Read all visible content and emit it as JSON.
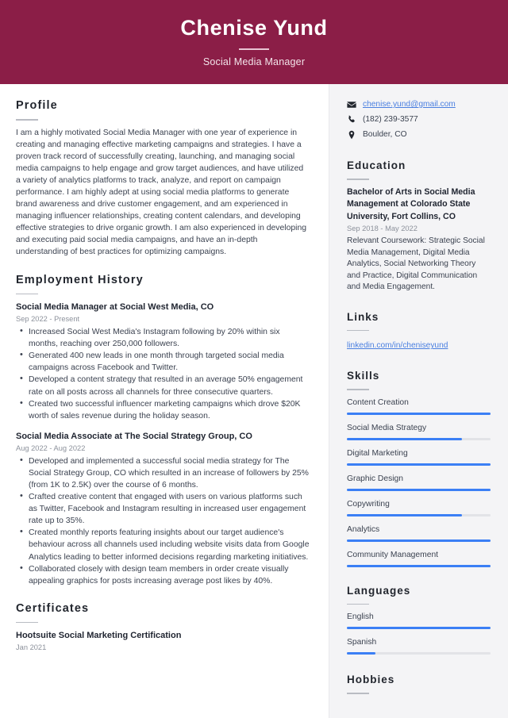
{
  "header": {
    "name": "Chenise Yund",
    "job_title": "Social Media Manager",
    "bg_color": "#8b1e47"
  },
  "main": {
    "profile": {
      "heading": "Profile",
      "text": "I am a highly motivated Social Media Manager with one year of experience in creating and managing effective marketing campaigns and strategies. I have a proven track record of successfully creating, launching, and managing social media campaigns to help engage and grow target audiences, and have utilized a variety of analytics platforms to track, analyze, and report on campaign performance. I am highly adept at using social media platforms to generate brand awareness and drive customer engagement, and am experienced in managing influencer relationships, creating content calendars, and developing effective strategies to drive organic growth. I am also experienced in developing and executing paid social media campaigns, and have an in-depth understanding of best practices for optimizing campaigns."
    },
    "employment": {
      "heading": "Employment History",
      "jobs": [
        {
          "title": "Social Media Manager at Social West Media, CO",
          "date": "Sep 2022 - Present",
          "bullets": [
            "Increased Social West Media's Instagram following by 20% within six months, reaching over 250,000 followers.",
            "Generated 400 new leads in one month through targeted social media campaigns across Facebook and Twitter.",
            "Developed a content strategy that resulted in an average 50% engagement rate on all posts across all channels for three consecutive quarters.",
            "Created two successful influencer marketing campaigns which drove $20K worth of sales revenue during the holiday season."
          ]
        },
        {
          "title": "Social Media Associate at The Social Strategy Group, CO",
          "date": "Aug 2022 - Aug 2022",
          "bullets": [
            "Developed and implemented a successful social media strategy for The Social Strategy Group, CO which resulted in an increase of followers by 25% (from 1K to 2.5K) over the course of 6 months.",
            "Crafted creative content that engaged with users on various platforms such as Twitter, Facebook and Instagram resulting in increased user engagement rate up to 35%.",
            "Created monthly reports featuring insights about our target audience's behaviour across all channels used including website visits data from Google Analytics leading to better informed decisions regarding marketing initiatives.",
            "Collaborated closely with design team members in order create visually appealing graphics for posts increasing average post likes by 40%."
          ]
        }
      ]
    },
    "certificates": {
      "heading": "Certificates",
      "items": [
        {
          "title": "Hootsuite Social Marketing Certification",
          "date": "Jan 2021"
        }
      ]
    }
  },
  "sidebar": {
    "contact": [
      {
        "icon": "envelope-icon",
        "text": "chenise.yund@gmail.com",
        "is_link": true
      },
      {
        "icon": "phone-icon",
        "text": "(182) 239-3577",
        "is_link": false
      },
      {
        "icon": "location-pin-icon",
        "text": "Boulder, CO",
        "is_link": false
      }
    ],
    "education": {
      "heading": "Education",
      "items": [
        {
          "title": "Bachelor of Arts in Social Media Management at Colorado State University, Fort Collins, CO",
          "date": "Sep 2018 - May 2022",
          "description": "Relevant Coursework: Strategic Social Media Management, Digital Media Analytics, Social Networking Theory and Practice, Digital Communication and Media Engagement."
        }
      ]
    },
    "links": {
      "heading": "Links",
      "items": [
        "linkedin.com/in/cheniseyund"
      ]
    },
    "skills": {
      "heading": "Skills",
      "accent_color": "#3b7ff5",
      "items": [
        {
          "label": "Content Creation",
          "level": 100
        },
        {
          "label": "Social Media Strategy",
          "level": 80
        },
        {
          "label": "Digital Marketing",
          "level": 100
        },
        {
          "label": "Graphic Design",
          "level": 100
        },
        {
          "label": "Copywriting",
          "level": 80
        },
        {
          "label": "Analytics",
          "level": 100
        },
        {
          "label": "Community Management",
          "level": 100
        }
      ]
    },
    "languages": {
      "heading": "Languages",
      "items": [
        {
          "label": "English",
          "level": 100
        },
        {
          "label": "Spanish",
          "level": 20
        }
      ]
    },
    "hobbies": {
      "heading": "Hobbies"
    }
  }
}
